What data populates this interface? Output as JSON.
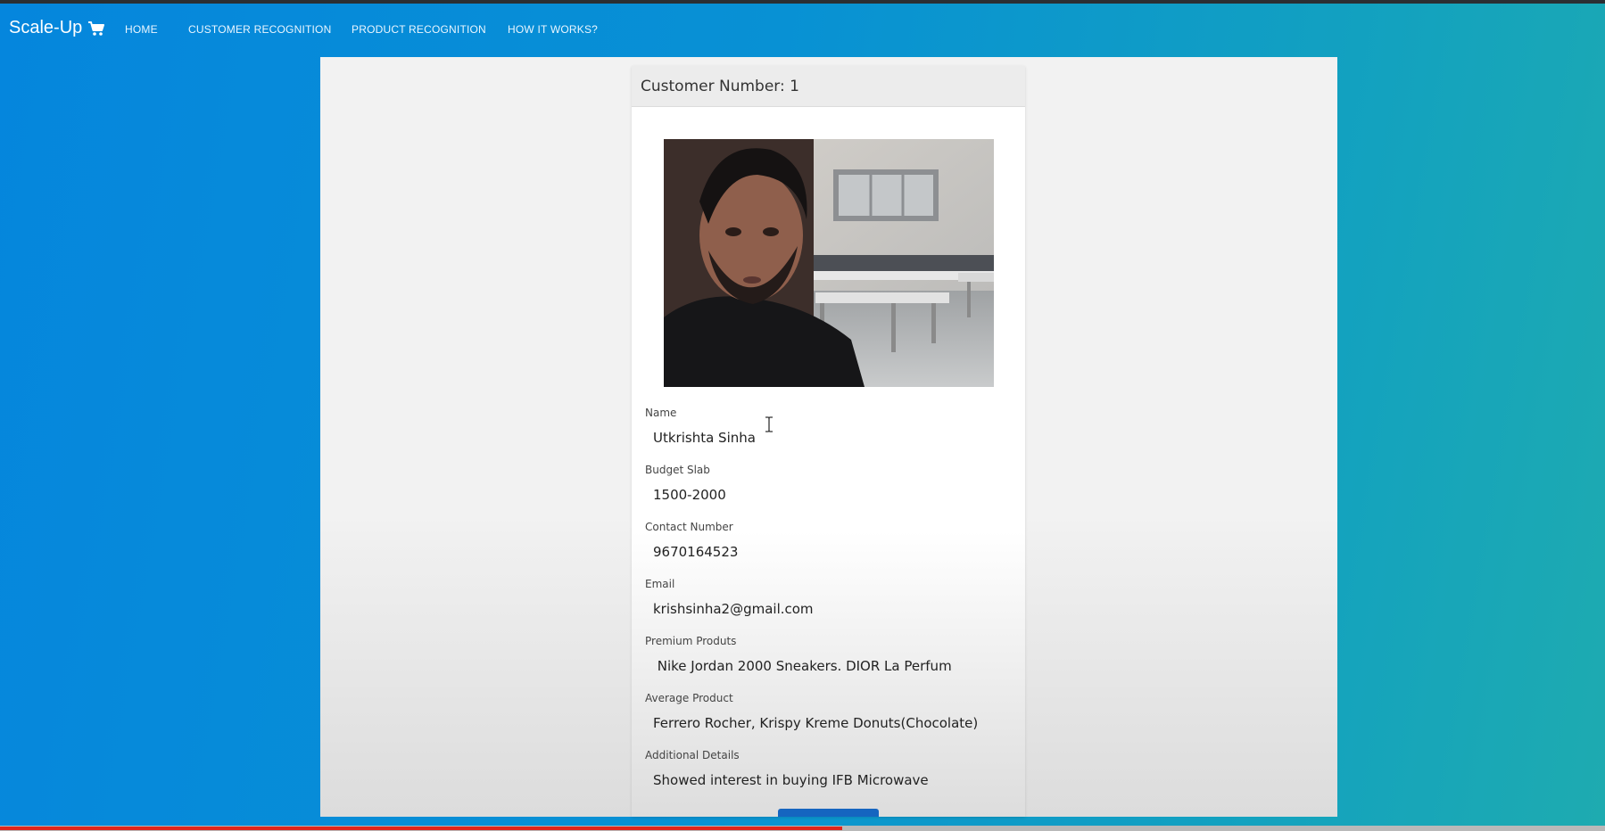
{
  "navbar": {
    "brand": "Scale-Up",
    "links": [
      "HOME",
      "CUSTOMER RECOGNITION",
      "PRODUCT RECOGNITION",
      "HOW IT WORKS?"
    ]
  },
  "card": {
    "header": "Customer Number: 1",
    "fields": [
      {
        "label": "Name",
        "value": "Utkrishta Sinha"
      },
      {
        "label": "Budget Slab",
        "value": "1500-2000"
      },
      {
        "label": "Contact Number",
        "value": "9670164523"
      },
      {
        "label": "Email",
        "value": "krishsinha2@gmail.com"
      },
      {
        "label": "Premium Produts",
        "value": " Nike Jordan 2000 Sneakers. DIOR La Perfum"
      },
      {
        "label": "Average Product",
        "value": "Ferrero Rocher, Krispy Kreme Donuts(Chocolate)"
      },
      {
        "label": "Additional Details",
        "value": "Showed interest in buying IFB Microwave"
      }
    ]
  },
  "icons": {
    "brand_icon": "shopping-cart-icon",
    "cursor": "text-cursor-icon"
  },
  "colors": {
    "accent_button": "#1565c0",
    "progress": "#e0251b"
  },
  "video_progress": 0.525
}
